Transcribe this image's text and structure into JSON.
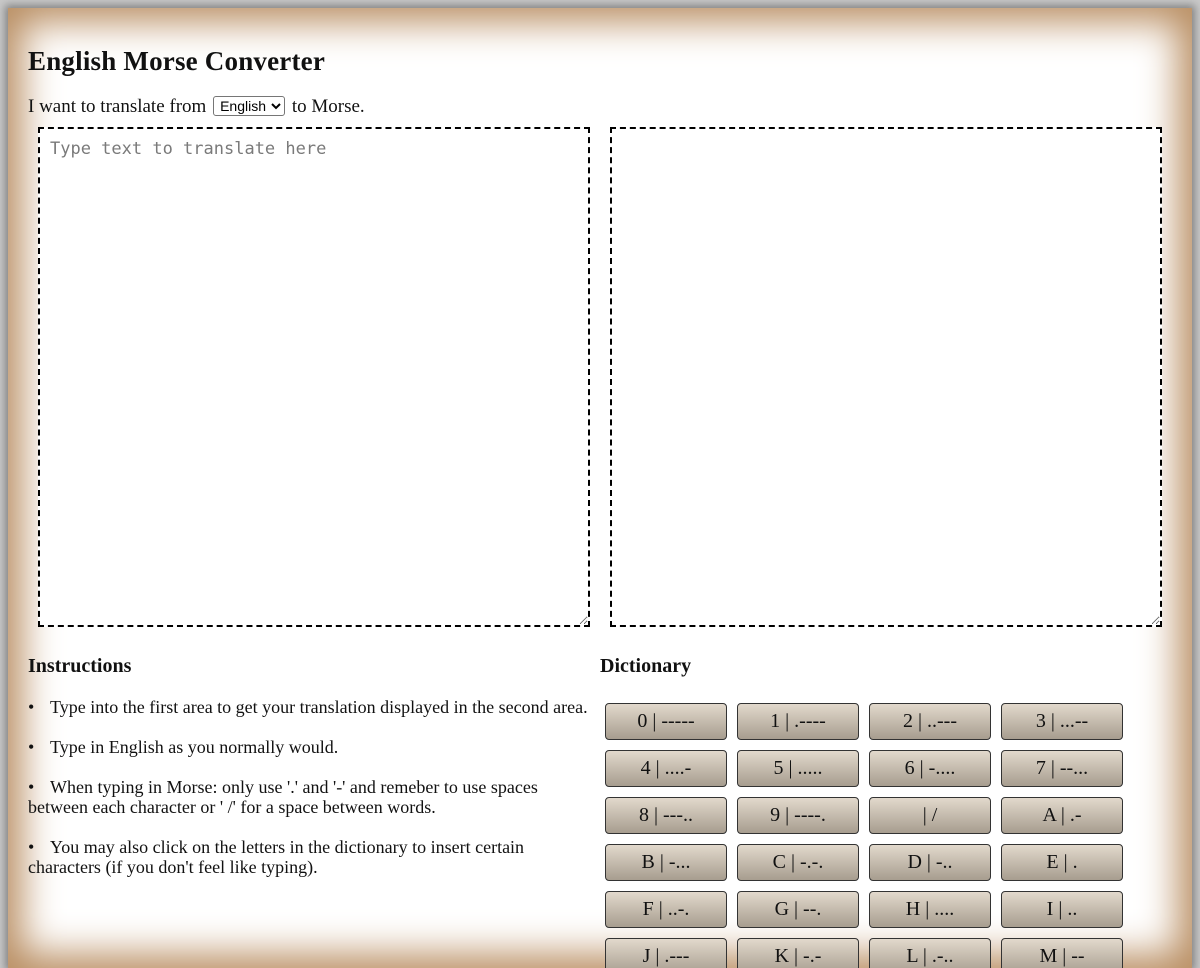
{
  "page": {
    "title": "English Morse Converter"
  },
  "translate_line": {
    "prefix": "I want to translate from",
    "selected_language": "English",
    "suffix": "to Morse."
  },
  "input": {
    "placeholder": "Type text to translate here",
    "value": ""
  },
  "output": {
    "value": ""
  },
  "instructions": {
    "heading": "Instructions",
    "items": [
      "Type into the first area to get your translation displayed in the second area.",
      "Type in English as you normally would.",
      "When typing in Morse: only use '.' and '-' and remeber to use spaces between each character or ' /' for a space between words.",
      "You may also click on the letters in the dictionary to insert certain characters (if you don't feel like typing)."
    ]
  },
  "dictionary": {
    "heading": "Dictionary",
    "entries": [
      "0 | -----",
      "1 | .----",
      "2 | ..---",
      "3 | ...--",
      "4 | ....-",
      "5 | .....",
      "6 | -....",
      "7 | --...",
      "8 | ---..",
      "9 | ----.",
      " | /",
      "A | .-",
      "B | -...",
      "C | -.-.",
      "D | -..",
      "E | .",
      "F | ..-.",
      "G | --.",
      "H | ....",
      "I | ..",
      "J | .---",
      "K | -.-",
      "L | .-..",
      "M | --"
    ]
  },
  "colors": {
    "paper_edge": "#b98e62",
    "button_top": "#e2d9cc",
    "button_bottom": "#a79d8f"
  }
}
